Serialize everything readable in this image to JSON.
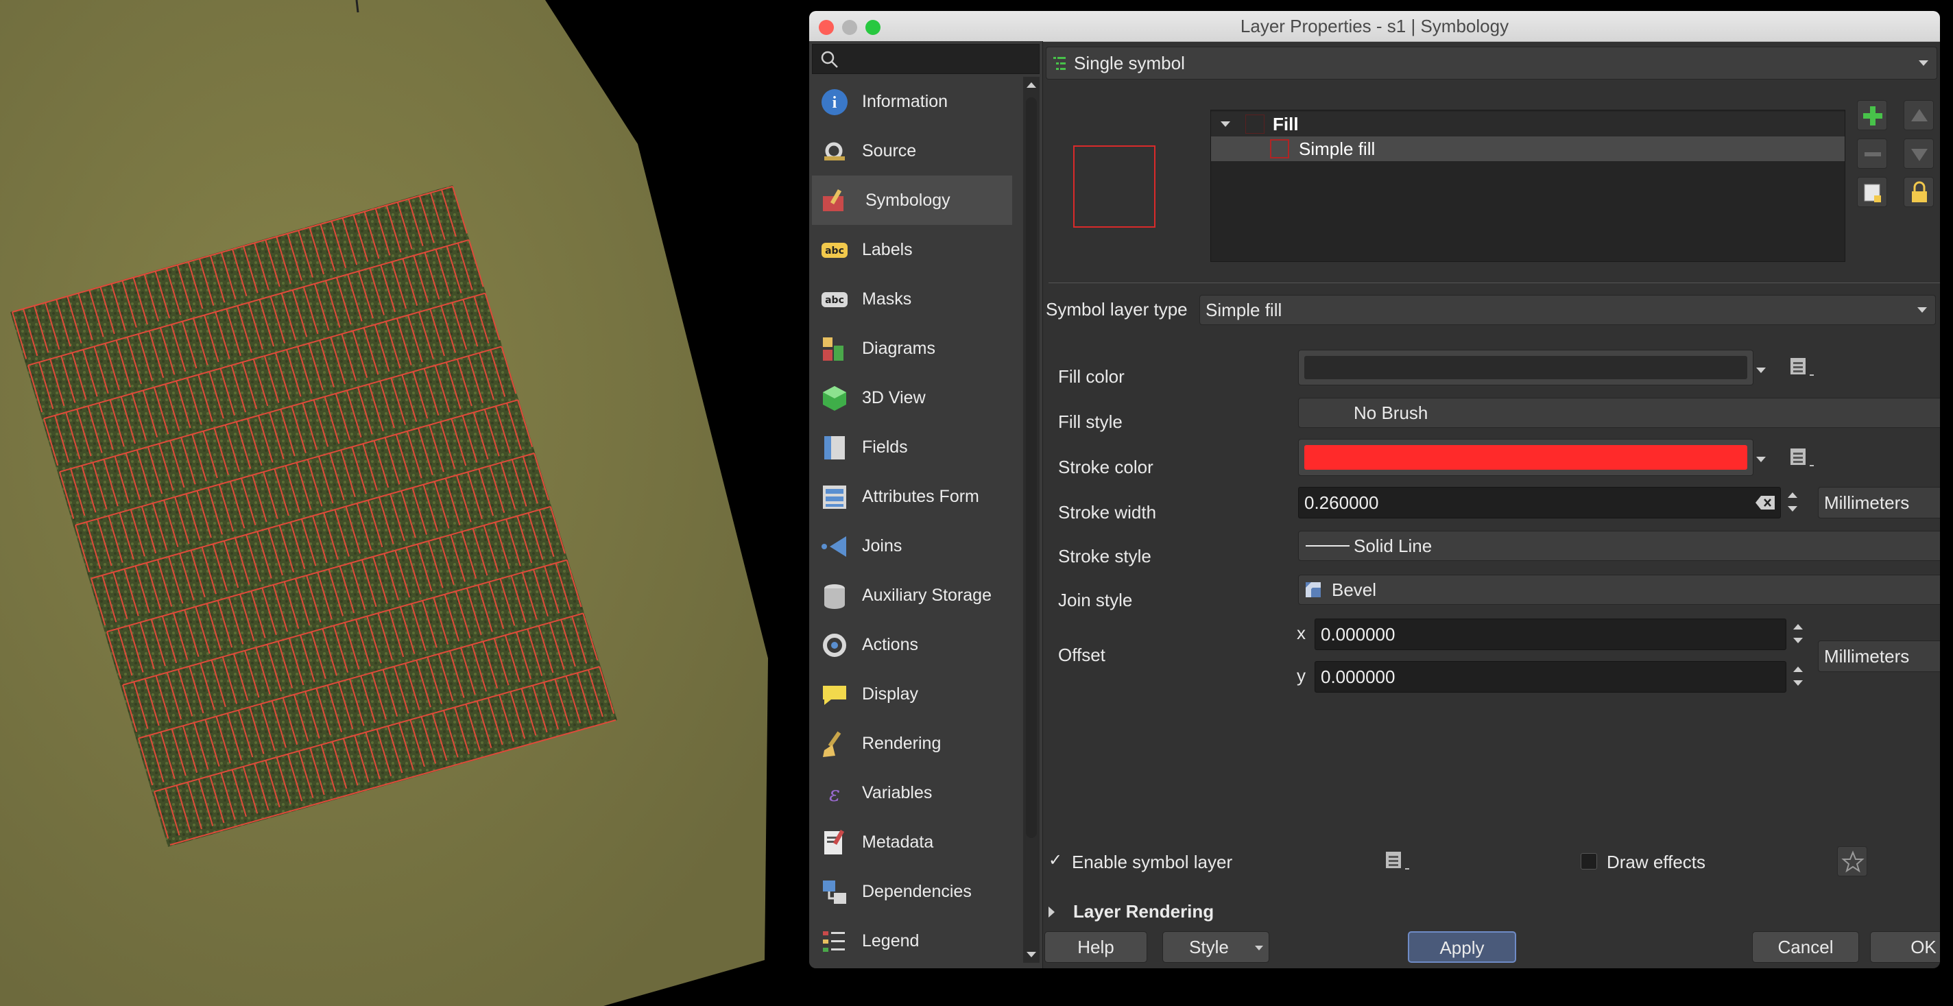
{
  "dialog": {
    "title": "Layer Properties - s1 | Symbology"
  },
  "sidebar": {
    "search_placeholder": "",
    "items": [
      {
        "label": "Information",
        "icon": "information-icon"
      },
      {
        "label": "Source",
        "icon": "source-icon"
      },
      {
        "label": "Symbology",
        "icon": "symbology-icon"
      },
      {
        "label": "Labels",
        "icon": "labels-icon"
      },
      {
        "label": "Masks",
        "icon": "masks-icon"
      },
      {
        "label": "Diagrams",
        "icon": "diagrams-icon"
      },
      {
        "label": "3D View",
        "icon": "3d-view-icon"
      },
      {
        "label": "Fields",
        "icon": "fields-icon"
      },
      {
        "label": "Attributes Form",
        "icon": "attributes-form-icon"
      },
      {
        "label": "Joins",
        "icon": "joins-icon"
      },
      {
        "label": "Auxiliary Storage",
        "icon": "auxiliary-storage-icon"
      },
      {
        "label": "Actions",
        "icon": "actions-icon"
      },
      {
        "label": "Display",
        "icon": "display-icon"
      },
      {
        "label": "Rendering",
        "icon": "rendering-icon"
      },
      {
        "label": "Variables",
        "icon": "variables-icon"
      },
      {
        "label": "Metadata",
        "icon": "metadata-icon"
      },
      {
        "label": "Dependencies",
        "icon": "dependencies-icon"
      },
      {
        "label": "Legend",
        "icon": "legend-icon"
      }
    ],
    "active": "Symbology"
  },
  "renderer": {
    "type": "Single symbol"
  },
  "symbol_tree": {
    "root": "Fill",
    "child": "Simple fill"
  },
  "symbol_layer": {
    "type_label": "Symbol layer type",
    "type_value": "Simple fill",
    "fill_color_label": "Fill color",
    "fill_color": "#2a2a2a",
    "fill_style_label": "Fill style",
    "fill_style": "No Brush",
    "stroke_color_label": "Stroke color",
    "stroke_color": "#ff2a2a",
    "stroke_width_label": "Stroke width",
    "stroke_width": "0.260000",
    "stroke_width_unit": "Millimeters",
    "stroke_style_label": "Stroke style",
    "stroke_style": "Solid Line",
    "join_style_label": "Join style",
    "join_style": "Bevel",
    "offset_label": "Offset",
    "offset_x_label": "x",
    "offset_x": "0.000000",
    "offset_y_label": "y",
    "offset_y": "0.000000",
    "offset_unit": "Millimeters"
  },
  "options": {
    "enable_symbol_layer": "Enable symbol layer",
    "enable_checked": true,
    "draw_effects": "Draw effects",
    "draw_effects_checked": false,
    "layer_rendering": "Layer Rendering"
  },
  "buttons": {
    "help": "Help",
    "style": "Style",
    "apply": "Apply",
    "cancel": "Cancel",
    "ok": "OK"
  },
  "colors": {
    "accent": "#6f8bc6",
    "plot_outline": "#e04a3a",
    "field_soil": "#7d7a45"
  }
}
